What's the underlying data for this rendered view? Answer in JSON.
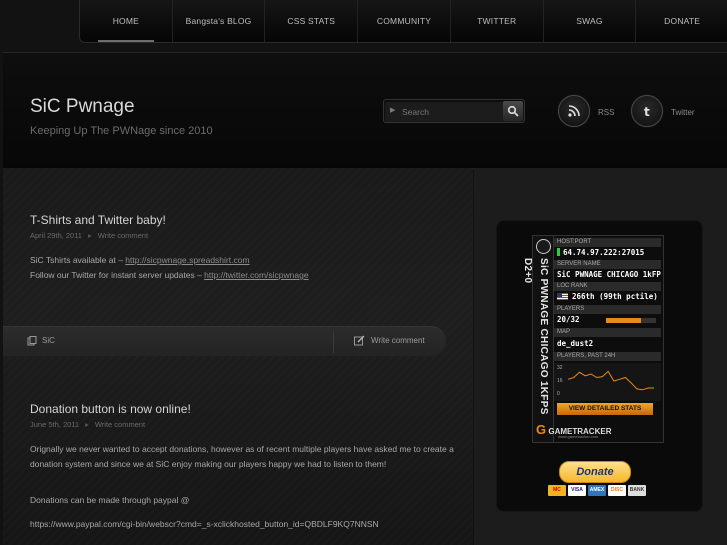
{
  "nav": {
    "items": [
      {
        "label": "HOME",
        "active": true
      },
      {
        "label": "Bangsta's BLOG"
      },
      {
        "label": "CSS STATS"
      },
      {
        "label": "COMMUNITY"
      },
      {
        "label": "TWITTER"
      },
      {
        "label": "SWAG"
      },
      {
        "label": "DONATE"
      }
    ]
  },
  "header": {
    "title": "SiC Pwnage",
    "tagline": "Keeping Up The PWNage since 2010",
    "search_placeholder": "Search",
    "rss_label": "RSS",
    "twitter_label": "Twitter"
  },
  "posts": [
    {
      "title": "T-Shirts and Twitter baby!",
      "date": "April 29th, 2011",
      "comment_link": "Write comment",
      "line1_prefix": "SiC Tshirts available at – ",
      "line1_link": "http://sicpwnage.spreadshirt.com",
      "line2_prefix": "Follow our Twitter for instant server updates – ",
      "line2_link": "http://twitter.com/sicpwnage",
      "author": "SiC",
      "footer_comment": "Write comment"
    },
    {
      "title": "Donation button is now online!",
      "date": "June 5th, 2011",
      "comment_link": "Write comment",
      "paragraph1": "Orignally we never wanted to accept donations, however as of recent multiple players have asked me to create a donation system and since we at SiC enjoy making our players happy we had to listen to them!",
      "paragraph2": "Donations can be made through paypal @",
      "paragraph3": "https://www.paypal.com/cgi-bin/webscr?cmd=_s-xclickhosted_button_id=QBDLF9KQ7NNSN"
    }
  ],
  "server_banner": {
    "vertical_title": "SiC PWNAGE CHICAGO 1KFPS D2+0",
    "host_port_label": "HOST:PORT",
    "host_port": "64.74.97.222:27015",
    "server_name_label": "SERVER NAME",
    "server_name": "SiC PWNAGE CHICAGO 1kFP",
    "loc_rank_label": "LOC   RANK",
    "rank": "266th (99th pctile)",
    "players_label": "PLAYERS",
    "players": "20/32",
    "players_fill": 0.7,
    "map_label": "MAP",
    "map": "de_dust2",
    "history_label": "PLAYERS, PAST 24H",
    "graph_ticks": [
      "32",
      "16",
      "0"
    ],
    "graph_values": [
      18,
      20,
      26,
      22,
      24,
      20,
      21,
      27,
      16,
      18,
      20,
      14,
      7,
      6,
      8,
      8
    ],
    "detail_button": "VIEW DETAILED STATS",
    "logo_g": "G",
    "logo_text": "GAMETRACKER",
    "logo_url": "www.gametracker.com"
  },
  "donate": {
    "button_label": "Donate",
    "cards": [
      {
        "label": "MC",
        "bg": "#f3b21f",
        "fg": "#cc0000"
      },
      {
        "label": "VISA",
        "bg": "#ffffff",
        "fg": "#1a1f71"
      },
      {
        "label": "AMEX",
        "bg": "#2e77bc",
        "fg": "#ffffff"
      },
      {
        "label": "DISC",
        "bg": "#ffffff",
        "fg": "#e6791e"
      },
      {
        "label": "BANK",
        "bg": "#dddddd",
        "fg": "#333333"
      }
    ]
  }
}
